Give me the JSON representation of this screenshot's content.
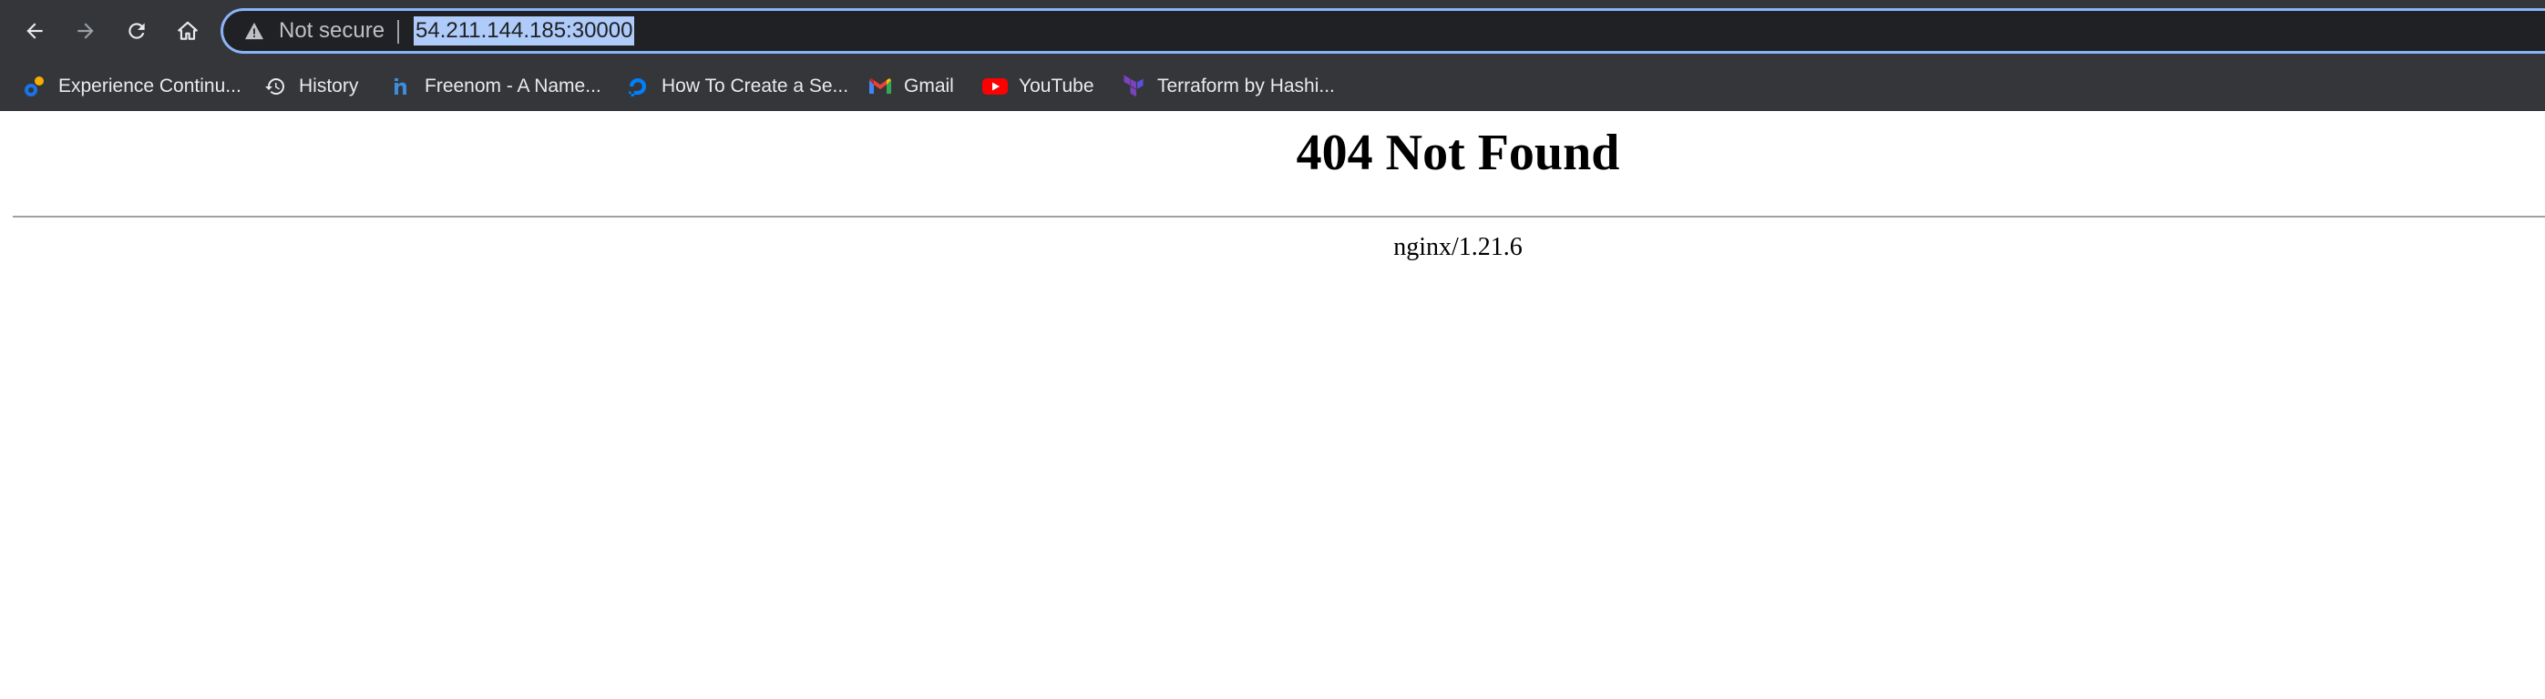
{
  "toolbar": {
    "back_icon": "arrow-left-icon",
    "forward_icon": "arrow-right-icon",
    "reload_icon": "reload-icon",
    "home_icon": "home-icon",
    "omnibox": {
      "security_icon": "warning-triangle-icon",
      "security_status": "Not secure",
      "url": "54.211.144.185:30000"
    }
  },
  "bookmarks": [
    {
      "label": "Experience Continu...",
      "icon": "dollar-logo-icon",
      "color": "#1a73e8"
    },
    {
      "label": "History",
      "icon": "history-icon",
      "color": "#e8eaed"
    },
    {
      "label": "Freenom - A Name...",
      "icon": "freenom-logo-icon",
      "color": "#3c8dde"
    },
    {
      "label": "How To Create a Se...",
      "icon": "digitalocean-logo-icon",
      "color": "#0080ff"
    },
    {
      "label": "Gmail",
      "icon": "gmail-logo-icon",
      "color": "#ea4335"
    },
    {
      "label": "YouTube",
      "icon": "youtube-logo-icon",
      "color": "#ff0000"
    },
    {
      "label": "Terraform by Hashi...",
      "icon": "terraform-logo-icon",
      "color": "#7b42bc"
    }
  ],
  "page": {
    "title": "404 Not Found",
    "signature": "nginx/1.21.6"
  },
  "colors": {
    "chrome_bg": "#35363a",
    "omnibox_bg": "#202124",
    "focus_ring": "#8ab4f8",
    "url_highlight": "#aecbfa"
  }
}
